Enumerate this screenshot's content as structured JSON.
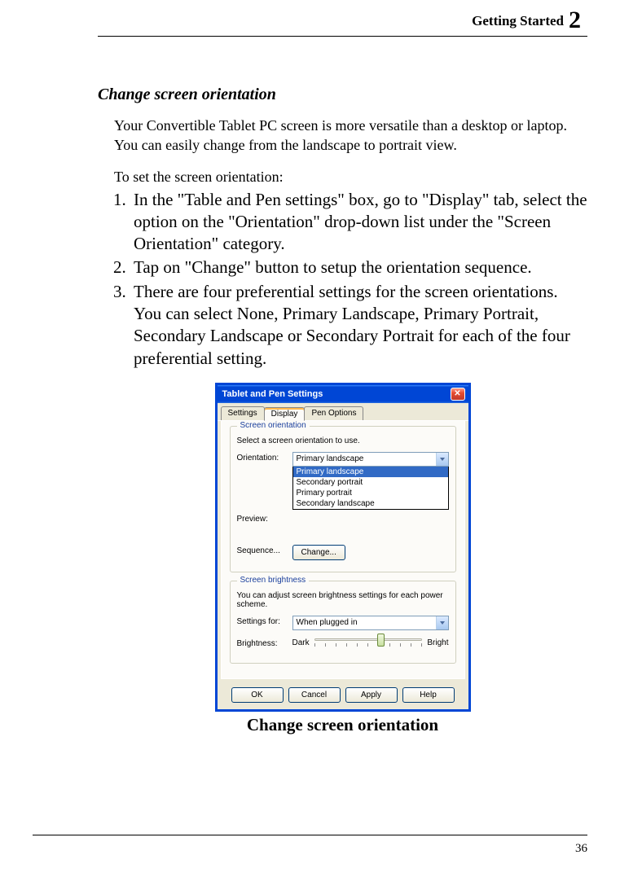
{
  "header": {
    "section_label": "Getting Started",
    "chapter_number": "2"
  },
  "heading": "Change screen orientation",
  "intro_para": "Your Convertible Tablet PC screen is more versatile than a desktop or laptop.    You can easily change from the landscape to portrait view.",
  "lead_in": "To set the screen orientation:",
  "steps": [
    "In the \"Table and Pen settings\" box, go to \"Display\" tab, select the option on the \"Orientation\" drop-down list under the \"Screen Orientation\" category.",
    "Tap on \"Change\" button to setup the orientation sequence.",
    "There are four preferential settings for the screen orientations. You can select None, Primary Landscape, Primary Portrait, Secondary Landscape or Secondary Portrait for each of the four preferential setting."
  ],
  "dialog": {
    "title": "Tablet and Pen Settings",
    "tabs": [
      "Settings",
      "Display",
      "Pen Options"
    ],
    "active_tab": 1,
    "group_orientation": {
      "legend": "Screen orientation",
      "desc": "Select a screen orientation to use.",
      "orientation_label": "Orientation:",
      "orientation_value": "Primary landscape",
      "options": [
        "Primary landscape",
        "Secondary portrait",
        "Primary portrait",
        "Secondary landscape"
      ],
      "preview_label": "Preview:",
      "sequence_label": "Sequence...",
      "change_btn": "Change..."
    },
    "group_brightness": {
      "legend": "Screen brightness",
      "desc": "You can adjust screen brightness settings for each power scheme.",
      "settings_for_label": "Settings for:",
      "settings_for_value": "When plugged in",
      "brightness_label": "Brightness:",
      "dark_label": "Dark",
      "bright_label": "Bright"
    },
    "buttons": {
      "ok": "OK",
      "cancel": "Cancel",
      "apply": "Apply",
      "help": "Help"
    }
  },
  "figure_caption": "Change screen orientation",
  "page_number": "36"
}
